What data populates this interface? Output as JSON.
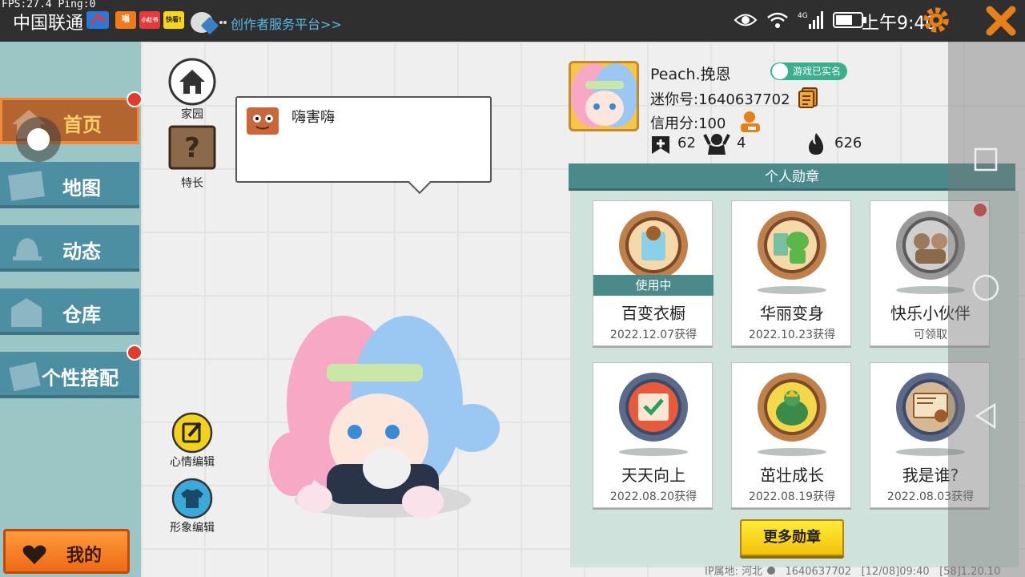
{
  "status_bar": {
    "fps_text": "FPS:27.4  Ping:0",
    "carrier": "中国联通",
    "mini_icons": [
      "唱",
      "小红书",
      "快看!"
    ],
    "creator_link": "创作者服务平台>>",
    "network": "4G",
    "time": "上午9:40",
    "icons": [
      "eye-icon",
      "wifi-icon",
      "signal-icon",
      "battery-icon",
      "gear-icon",
      "close-icon"
    ]
  },
  "sidebar": {
    "items": [
      {
        "label": "首页",
        "icon": "home-icon",
        "active": true,
        "badge": true
      },
      {
        "label": "地图",
        "icon": "map-icon",
        "active": false,
        "badge": false
      },
      {
        "label": "动态",
        "icon": "bell-icon",
        "active": false,
        "badge": false
      },
      {
        "label": "仓库",
        "icon": "warehouse-icon",
        "active": false,
        "badge": false
      },
      {
        "label": "个性搭配",
        "icon": "outfit-icon",
        "active": false,
        "badge": true
      }
    ],
    "mine_label": "我的"
  },
  "home": {
    "home_label": "家园",
    "talent_label": "特长",
    "mood_edit_label": "心情编辑",
    "look_edit_label": "形象编辑",
    "speech": "嗨害嗨"
  },
  "profile": {
    "nickname": "Peach.挽恩",
    "verified_badge": "游戏已实名",
    "mini_id": "迷你号:1640637702",
    "credit": "信用分:100",
    "stats": {
      "likes": "62",
      "fans": "4",
      "hot": "626"
    }
  },
  "medals": {
    "title": "个人勋章",
    "items": [
      {
        "name": "百变衣橱",
        "date": "2022.12.07获得",
        "status": "使用中",
        "accent": "#c0804a"
      },
      {
        "name": "华丽变身",
        "date": "2022.10.23获得",
        "status": "",
        "accent": "#c0804a"
      },
      {
        "name": "快乐小伙伴",
        "date": "可领取",
        "status": "",
        "accent": "#8a8a8a"
      },
      {
        "name": "天天向上",
        "date": "2022.08.20获得",
        "status": "",
        "accent": "#5a6b8a"
      },
      {
        "name": "茁壮成长",
        "date": "2022.08.19获得",
        "status": "",
        "accent": "#c0804a"
      },
      {
        "name": "我是谁?",
        "date": "2022.08.03获得",
        "status": "",
        "accent": "#5a6b8a"
      }
    ],
    "more_button": "更多勋章"
  },
  "footer": {
    "ip_location": "IP属地: 河北",
    "id": "1640637702",
    "timestamp": "[12/08]09:40",
    "code": "[58]1.20.10"
  },
  "colors": {
    "sidebar_active": "#b3652f",
    "sidebar_item": "#4d8fa2",
    "accent_orange": "#ee6a16",
    "medal_header": "#4a8a8a"
  }
}
